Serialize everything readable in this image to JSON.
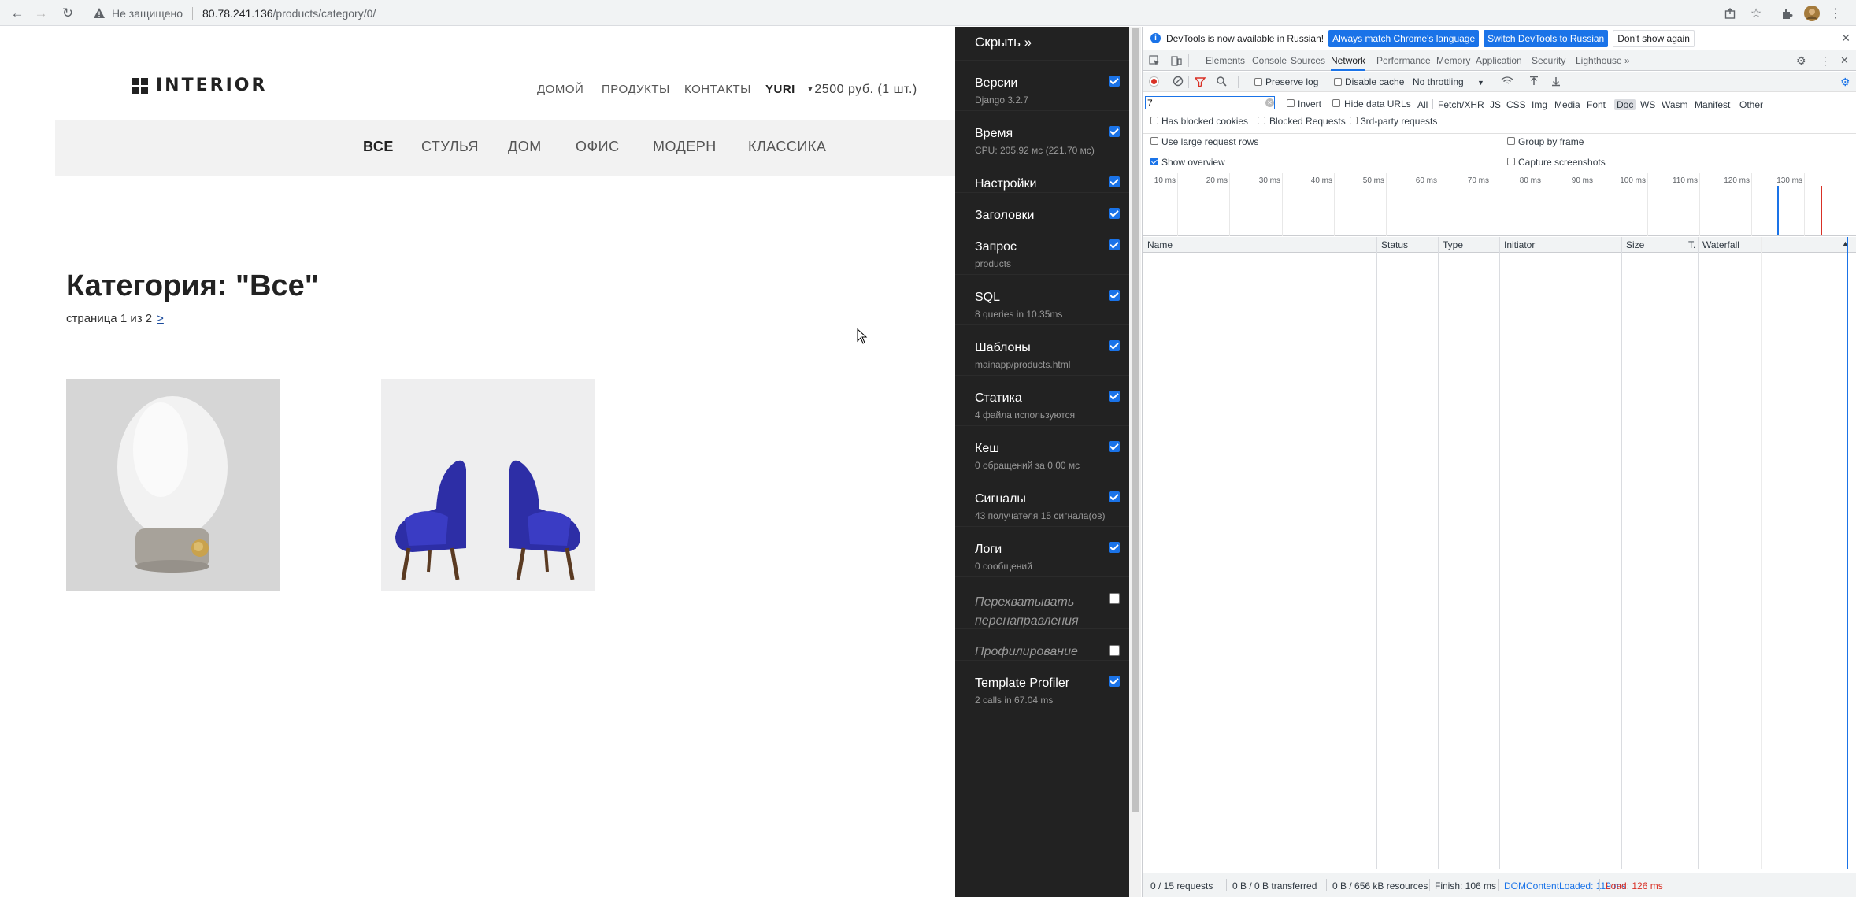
{
  "browser": {
    "security_label": "Не защищено",
    "url_host": "80.78.241.136",
    "url_path": "/products/category/0/"
  },
  "site": {
    "logo": "INTERIOR",
    "nav": [
      "Домой",
      "Продукты",
      "Контакты"
    ],
    "user": "YURI",
    "cart": "2500 руб. (1 шт.)",
    "categories": [
      "все",
      "стулья",
      "дом",
      "офис",
      "модерн",
      "классика"
    ],
    "page_title": "Категория: \"Все\"",
    "paging_text": "страница 1 из 2",
    "paging_next": ">"
  },
  "debug_toolbar": {
    "hide_label": "Скрыть »",
    "panels": [
      {
        "title": "Версии",
        "subtitle": "Django 3.2.7",
        "enabled": true
      },
      {
        "title": "Время",
        "subtitle": "CPU: 205.92 мс (221.70 мс)",
        "enabled": true
      },
      {
        "title": "Настройки",
        "subtitle": "",
        "enabled": true
      },
      {
        "title": "Заголовки",
        "subtitle": "",
        "enabled": true
      },
      {
        "title": "Запрос",
        "subtitle": "products",
        "enabled": true
      },
      {
        "title": "SQL",
        "subtitle": "8 queries in 10.35ms",
        "enabled": true
      },
      {
        "title": "Шаблоны",
        "subtitle": "mainapp/products.html",
        "enabled": true
      },
      {
        "title": "Статика",
        "subtitle": "4 файла используются",
        "enabled": true
      },
      {
        "title": "Кеш",
        "subtitle": "0 обращений за 0.00 мс",
        "enabled": true
      },
      {
        "title": "Сигналы",
        "subtitle": "43 получателя 15 сигнала(ов)",
        "enabled": true
      },
      {
        "title": "Логи",
        "subtitle": "0 сообщений",
        "enabled": true
      },
      {
        "title": "Перехватывать перенаправления",
        "subtitle": "",
        "enabled": false
      },
      {
        "title": "Профилирование",
        "subtitle": "",
        "enabled": false
      },
      {
        "title": "Template Profiler",
        "subtitle": "2 calls in 67.04 ms",
        "enabled": true
      }
    ]
  },
  "devtools": {
    "info_message": "DevTools is now available in Russian!",
    "btn_match": "Always match Chrome's language",
    "btn_switch": "Switch DevTools to Russian",
    "btn_dismiss": "Don't show again",
    "tabs": [
      "Elements",
      "Console",
      "Sources",
      "Network",
      "Performance",
      "Memory",
      "Application",
      "Security",
      "Lighthouse"
    ],
    "active_tab": "Network",
    "preserve_log": "Preserve log",
    "disable_cache": "Disable cache",
    "throttling": "No throttling",
    "filter_value": "7",
    "invert": "Invert",
    "hide_data_urls": "Hide data URLs",
    "types": [
      "All",
      "Fetch/XHR",
      "JS",
      "CSS",
      "Img",
      "Media",
      "Font",
      "Doc",
      "WS",
      "Wasm",
      "Manifest",
      "Other"
    ],
    "selected_type": "Doc",
    "has_blocked_cookies": "Has blocked cookies",
    "blocked_requests": "Blocked Requests",
    "third_party": "3rd-party requests",
    "large_rows": "Use large request rows",
    "show_overview": "Show overview",
    "group_by_frame": "Group by frame",
    "capture_screenshots": "Capture screenshots",
    "timeline_ticks": [
      "10 ms",
      "20 ms",
      "30 ms",
      "40 ms",
      "50 ms",
      "60 ms",
      "70 ms",
      "80 ms",
      "90 ms",
      "100 ms",
      "110 ms",
      "120 ms",
      "130 ms"
    ],
    "columns": [
      "Name",
      "Status",
      "Type",
      "Initiator",
      "Size",
      "T.",
      "Waterfall"
    ],
    "status": {
      "requests": "0 / 15 requests",
      "transferred": "0 B / 0 B transferred",
      "resources": "0 B / 656 kB resources",
      "finish": "Finish: 106 ms",
      "dcl": "DOMContentLoaded: 119 ms",
      "load": "Load: 126 ms"
    }
  },
  "colors": {
    "accent": "#1a73e8",
    "dcl": "#1a73e8",
    "load": "#d93025",
    "toolbar_bg": "#222222"
  }
}
